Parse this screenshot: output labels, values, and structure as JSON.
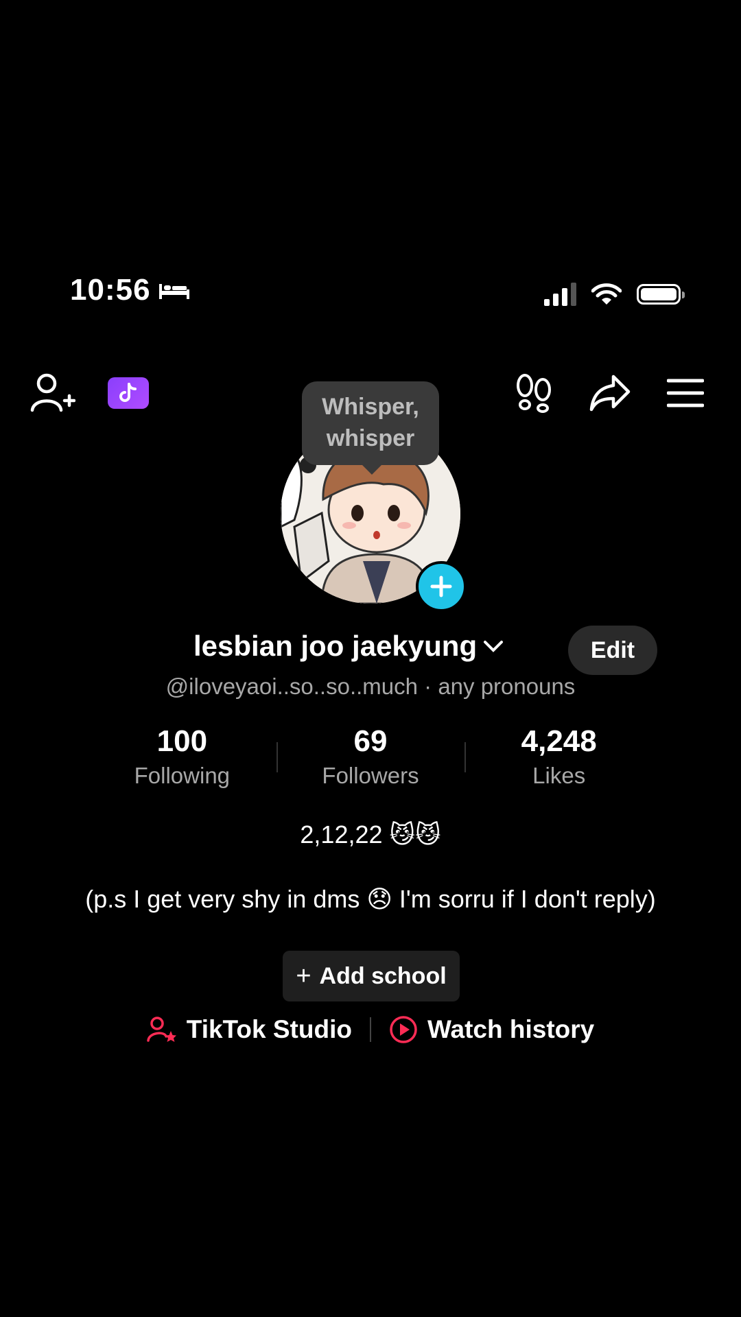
{
  "status_bar": {
    "time": "10:56",
    "sleep_icon": "bed-icon",
    "signal_bars_active": 3,
    "wifi_icon": "wifi-icon",
    "battery_icon": "battery-icon"
  },
  "top_nav": {
    "add_friend_icon": "add-user-icon",
    "ticket_icon": "tiktok-ticket-icon",
    "footprints_icon": "footprints-icon",
    "share_icon": "share-arrow-icon",
    "menu_icon": "hamburger-menu-icon"
  },
  "tooltip": {
    "line1": "Whisper,",
    "line2": "whisper"
  },
  "profile": {
    "display_name": "lesbian joo jaekyung",
    "edit_label": "Edit",
    "handle": "@iloveyaoi..so..so..much",
    "pronouns": "· any pronouns"
  },
  "stats": [
    {
      "value": "100",
      "label": "Following"
    },
    {
      "value": "69",
      "label": "Followers"
    },
    {
      "value": "4,248",
      "label": "Likes"
    }
  ],
  "bio": {
    "line1": "2,12,22 😼😼",
    "line2": "(p.s I get very shy in dms 😞 I'm sorru if I don't reply)"
  },
  "add_school": {
    "plus": "+",
    "label": "Add school"
  },
  "links": {
    "studio": "TikTok Studio",
    "history": "Watch history"
  },
  "colors": {
    "background": "#000000",
    "accent_pink": "#fe2c55",
    "avatar_add": "#20c4e8",
    "ticket_purple": "#8a3ffc"
  }
}
